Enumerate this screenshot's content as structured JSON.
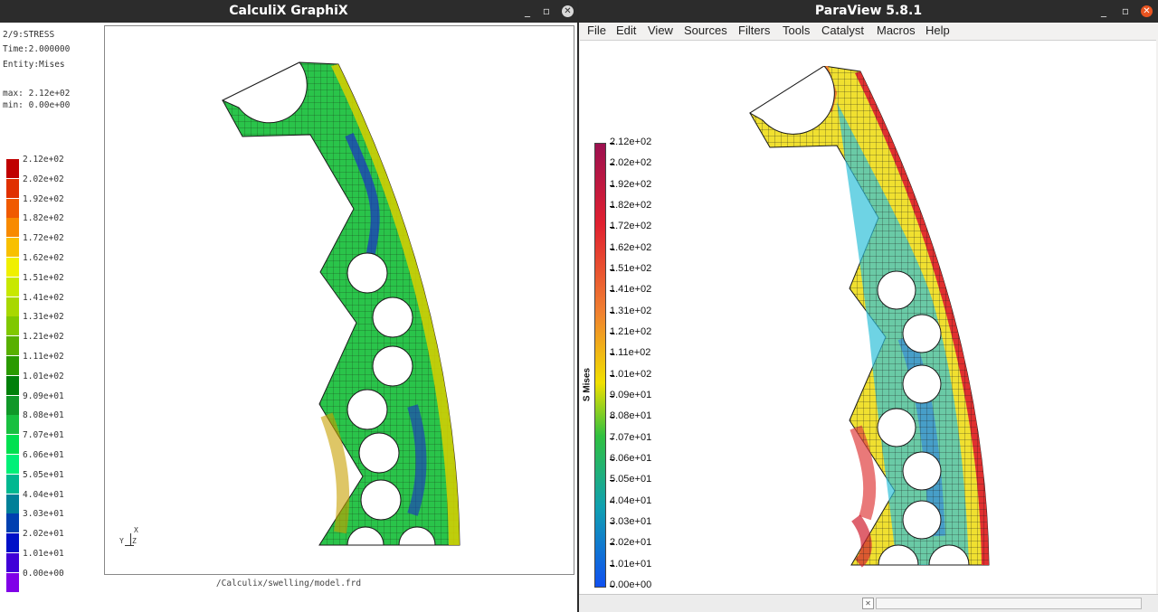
{
  "left_window": {
    "title": "CalculiX GraphiX",
    "controls": {
      "minimize": "_",
      "maximize": "▫",
      "close": "✕"
    },
    "info": {
      "step": "2/9:STRESS",
      "time": "Time:2.000000",
      "entity": "Entity:Mises",
      "max": "max: 2.12e+02",
      "min": "min: 0.00e+00"
    },
    "legend": [
      {
        "label": "2.12e+02",
        "color": "#c00000"
      },
      {
        "label": "2.02e+02",
        "color": "#e03000"
      },
      {
        "label": "1.92e+02",
        "color": "#f05a00"
      },
      {
        "label": "1.82e+02",
        "color": "#f88a00"
      },
      {
        "label": "1.72e+02",
        "color": "#f8c000"
      },
      {
        "label": "1.62e+02",
        "color": "#f0f000"
      },
      {
        "label": "1.51e+02",
        "color": "#c8e800"
      },
      {
        "label": "1.41e+02",
        "color": "#a8d800"
      },
      {
        "label": "1.31e+02",
        "color": "#80c800"
      },
      {
        "label": "1.21e+02",
        "color": "#58b000"
      },
      {
        "label": "1.11e+02",
        "color": "#2a9a00"
      },
      {
        "label": "1.01e+02",
        "color": "#00800a"
      },
      {
        "label": "9.09e+01",
        "color": "#109828"
      },
      {
        "label": "8.08e+01",
        "color": "#18c040"
      },
      {
        "label": "7.07e+01",
        "color": "#00e050"
      },
      {
        "label": "6.06e+01",
        "color": "#00f078"
      },
      {
        "label": "5.05e+01",
        "color": "#00b890"
      },
      {
        "label": "4.04e+01",
        "color": "#008098"
      },
      {
        "label": "3.03e+01",
        "color": "#0040b0"
      },
      {
        "label": "2.02e+01",
        "color": "#0010c8"
      },
      {
        "label": "1.01e+01",
        "color": "#4000d8"
      },
      {
        "label": "0.00e+00",
        "color": "#8000e8"
      }
    ],
    "axes": {
      "x": "X",
      "y": "Y",
      "z": "Z"
    },
    "file": "/Calculix/swelling/model.frd"
  },
  "right_window": {
    "title": "ParaView 5.8.1",
    "controls": {
      "minimize": "_",
      "maximize": "▫",
      "close": "✕"
    },
    "menu": [
      "File",
      "Edit",
      "View",
      "Sources",
      "Filters",
      "Tools",
      "Catalyst",
      "Macros",
      "Help"
    ],
    "legend_title": "S Mises",
    "legend": [
      "2.12e+02",
      "2.02e+02",
      "1.92e+02",
      "1.82e+02",
      "1.72e+02",
      "1.62e+02",
      "1.51e+02",
      "1.41e+02",
      "1.31e+02",
      "1.21e+02",
      "1.11e+02",
      "1.01e+02",
      "9.09e+01",
      "8.08e+01",
      "7.07e+01",
      "6.06e+01",
      "5.05e+01",
      "4.04e+01",
      "3.03e+01",
      "2.02e+01",
      "1.01e+01",
      "0.00e+00"
    ],
    "colorbar": {
      "top": "#9c1050",
      "upper": "#e02030",
      "mid_high": "#f08030",
      "mid": "#f0e000",
      "mid_low": "#30c040",
      "lower": "#10a0b0",
      "bottom": "#1050f0"
    }
  },
  "colors": {
    "titlebar": "#2c2c2c",
    "close": "#e95420"
  }
}
